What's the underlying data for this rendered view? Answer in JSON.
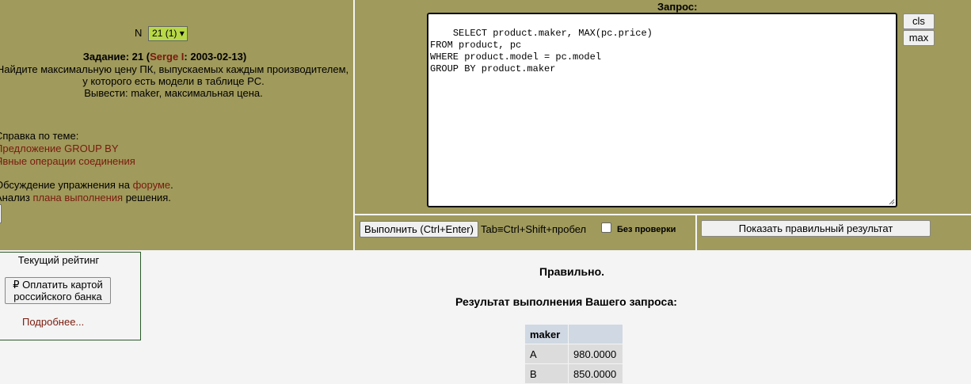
{
  "task": {
    "n_label": "N",
    "n_value": "21 (1)",
    "title_prefix": "Задание: 21 (",
    "author": "Serge I",
    "title_suffix": ": 2003-02-13)",
    "line1": "Найдите максимальную цену ПК, выпускаемых каждым производителем,",
    "line2": "у которого есть модели в таблице PC.",
    "line3": "Вывести: maker, максимальная цена."
  },
  "help": {
    "heading": "Справка по теме:",
    "link1": "Предложение GROUP BY",
    "link2": "Явные операции соединения",
    "forum_prefix": "Обсуждение упражнения на ",
    "forum_link": "форуме",
    "forum_suffix": ".",
    "plan_prefix": "Анализ ",
    "plan_link": "плана выполнения",
    "plan_suffix": " решения."
  },
  "query": {
    "label": "Запрос:",
    "text": "SELECT product.maker, MAX(pc.price)\nFROM product, pc\nWHERE product.model = pc.model\nGROUP BY product.maker",
    "cls_label": "cls",
    "max_label": "max"
  },
  "controls": {
    "execute_label": "Выполнить (Ctrl+Enter)",
    "tab_hint": "Tab≡Ctrl+Shift+пробел",
    "nocheck_label": "Без проверки",
    "show_result_label": "Показать правильный результат"
  },
  "rating": {
    "title": "Текущий рейтинг",
    "pay_label": "₽ Оплатить картой российского банка",
    "more_label": "Подробнее..."
  },
  "result": {
    "status": "Правильно.",
    "title": "Результат выполнения Вашего запроса:",
    "columns": [
      "maker",
      ""
    ],
    "rows": [
      [
        "A",
        "980.0000"
      ],
      [
        "B",
        "850.0000"
      ]
    ]
  }
}
